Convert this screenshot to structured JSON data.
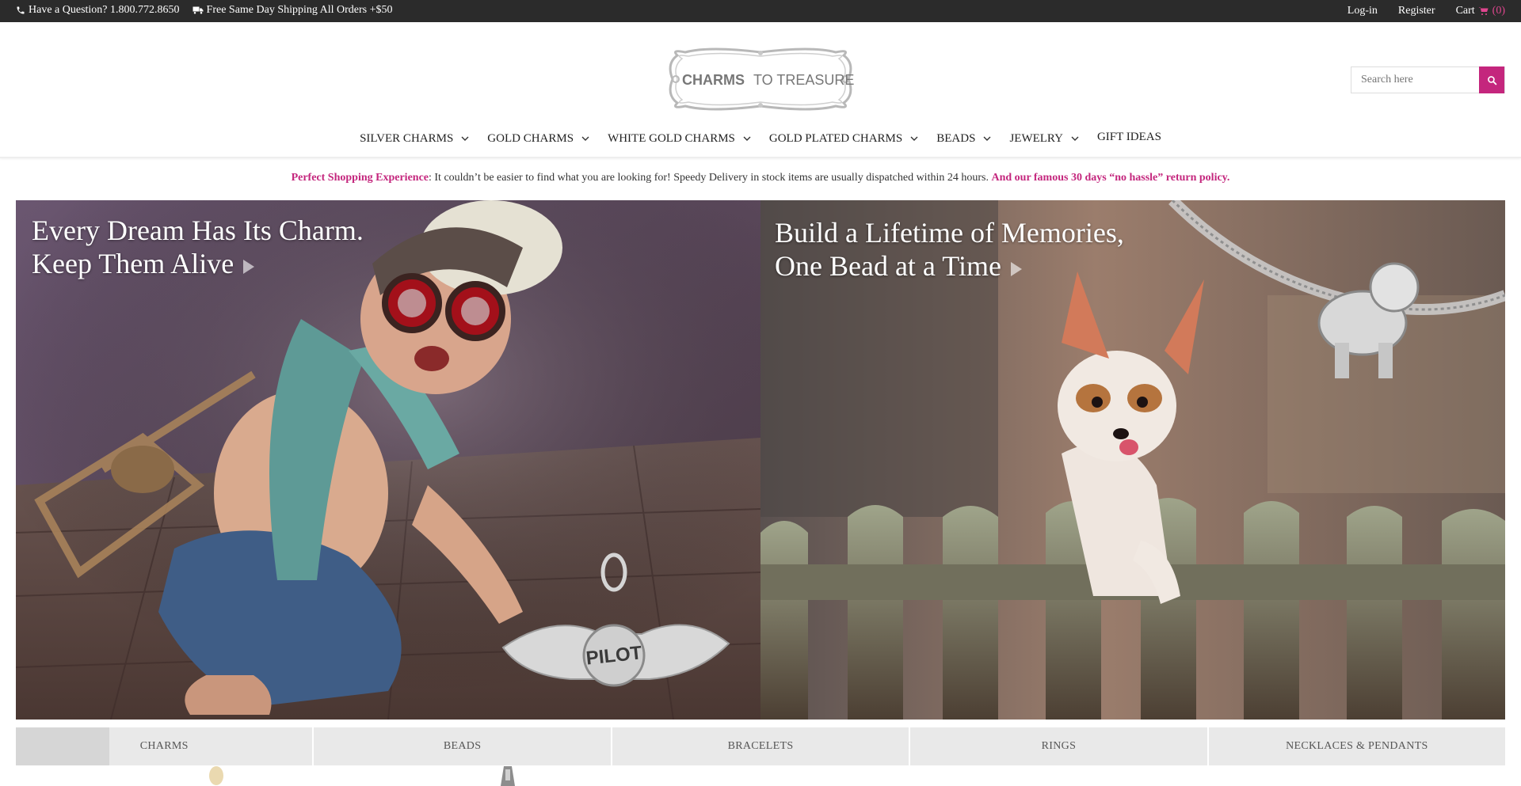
{
  "topbar": {
    "phone": "Have a Question? 1.800.772.8650",
    "shipping": "Free Same Day Shipping All Orders +$50",
    "login": "Log-in",
    "register": "Register",
    "cart_label": "Cart",
    "cart_count": "(0)",
    "icons": [
      "phone-icon",
      "truck-icon",
      "cart-icon"
    ]
  },
  "logo": {
    "text_bold": "CHARMS",
    "text_regular": "TO TREASURE"
  },
  "search": {
    "placeholder": "Search here",
    "icon": "search-icon"
  },
  "nav": {
    "items": [
      {
        "label": "SILVER CHARMS",
        "dropdown": true
      },
      {
        "label": "GOLD CHARMS",
        "dropdown": true
      },
      {
        "label": "WHITE GOLD CHARMS",
        "dropdown": true
      },
      {
        "label": "GOLD PLATED CHARMS",
        "dropdown": true
      },
      {
        "label": "BEADS",
        "dropdown": true
      },
      {
        "label": "JEWELRY",
        "dropdown": true
      },
      {
        "label": "GIFT IDEAS",
        "dropdown": false
      }
    ]
  },
  "promo": {
    "lead": "Perfect Shopping Experience",
    "body": ": It couldn’t be easier to find what you are looking for! Speedy Delivery in stock items are usually dispatched within 24 hours.",
    "tail": "And our famous 30 days “no hassle” return policy."
  },
  "hero": {
    "left": {
      "line1": "Every Dream Has Its Charm.",
      "line2": "Keep Them Alive",
      "charm_text": "PILOT"
    },
    "right": {
      "line1": "Build a Lifetime of Memories,",
      "line2": "One Bead at a Time"
    }
  },
  "categories": [
    "CHARMS",
    "BEADS",
    "BRACELETS",
    "RINGS",
    "NECKLACES & PENDANTS"
  ],
  "colors": {
    "accent": "#c4267d",
    "topbar": "#2b2b2b",
    "tab_bg": "#e9e9e9"
  }
}
